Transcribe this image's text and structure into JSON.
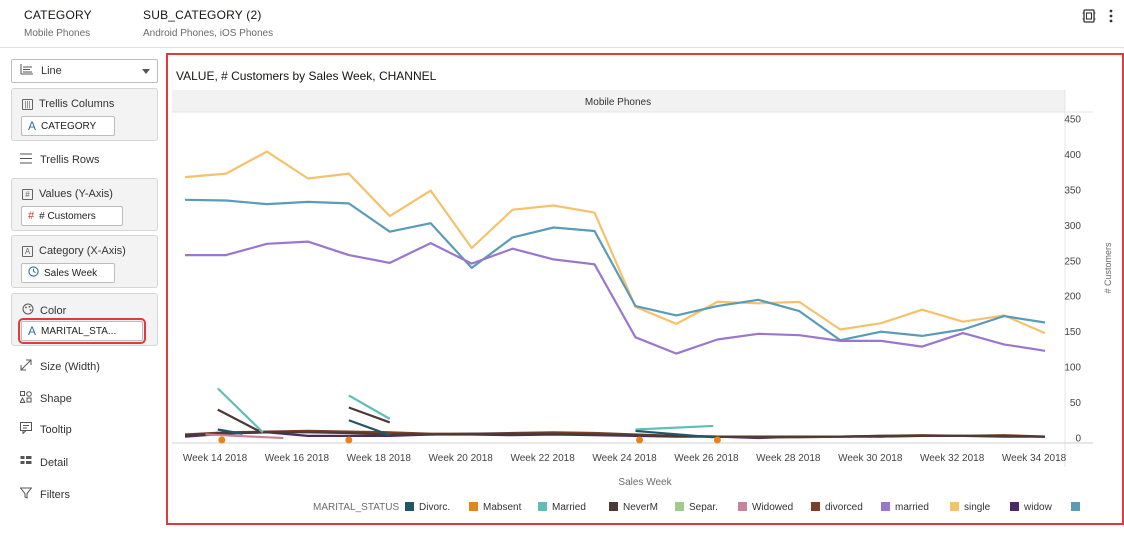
{
  "topbar": {
    "category_label": "CATEGORY",
    "category_value": "Mobile Phones",
    "subcategory_label": "SUB_CATEGORY (2)",
    "subcategory_value": "Android Phones, iOS Phones"
  },
  "panel": {
    "chart_type": "Line",
    "trellis_columns": "Trellis Columns",
    "trellis_columns_value": "CATEGORY",
    "trellis_rows": "Trellis Rows",
    "values_y": "Values (Y-Axis)",
    "values_y_value": "# Customers",
    "category_x": "Category (X-Axis)",
    "category_x_value": "Sales Week",
    "color": "Color",
    "color_value": "MARITAL_STA...",
    "size": "Size (Width)",
    "shape": "Shape",
    "tooltip": "Tooltip",
    "detail": "Detail",
    "filters": "Filters"
  },
  "colors": {
    "highlight": "#e03a3a",
    "single": "#f6c16b",
    "widow": "#5a9cb8",
    "married": "#9a77cc"
  },
  "chart_data": {
    "type": "line",
    "title": "VALUE, # Customers by Sales Week, CHANNEL",
    "panel_header": "Mobile Phones",
    "xlabel": "Sales Week",
    "ylabel": "# Customers",
    "ylim": [
      0,
      450
    ],
    "y_ticks": [
      0,
      50,
      100,
      150,
      200,
      250,
      300,
      350,
      400,
      450
    ],
    "axis_position": "right",
    "x_ticks": [
      "Week 14 2018",
      "Week 16 2018",
      "Week 18 2018",
      "Week 20 2018",
      "Week 22 2018",
      "Week 24 2018",
      "Week 26 2018",
      "Week 28 2018",
      "Week 30 2018",
      "Week 32 2018",
      "Week 34 2018"
    ],
    "x": [
      "Week 14 2018",
      "Week 15 2018",
      "Week 16 2018",
      "Week 17 2018",
      "Week 18 2018",
      "Week 19 2018",
      "Week 20 2018",
      "Week 21 2018",
      "Week 22 2018",
      "Week 23 2018",
      "Week 24 2018",
      "Week 25 2018",
      "Week 26 2018",
      "Week 27 2018",
      "Week 28 2018",
      "Week 29 2018",
      "Week 30 2018",
      "Week 31 2018",
      "Week 32 2018",
      "Week 33 2018",
      "Week 34 2018",
      "Week 35 2018"
    ],
    "legend_title": "MARITAL_STATUS",
    "legend_position": "bottom",
    "legend": [
      {
        "name": "Divorc.",
        "color": "#1f5668"
      },
      {
        "name": "Mabsent",
        "color": "#e2861b"
      },
      {
        "name": "Married",
        "color": "#5fbfb5"
      },
      {
        "name": "NeverM",
        "color": "#4b3a35"
      },
      {
        "name": "Separ.",
        "color": "#9fcb8b"
      },
      {
        "name": "Widowed",
        "color": "#c9849b"
      },
      {
        "name": "divorced",
        "color": "#7a4028"
      },
      {
        "name": "married",
        "color": "#9a77cc"
      },
      {
        "name": "single",
        "color": "#f6c16b"
      },
      {
        "name": "widow",
        "color": "#4b2a6a"
      },
      {
        "name": "",
        "color": "#5a9cb8"
      }
    ],
    "series": [
      {
        "key": "single",
        "color": "#f6c16b",
        "values": [
          368,
          373,
          404,
          366,
          373,
          313,
          349,
          268,
          322,
          328,
          318,
          185,
          161,
          192,
          190,
          192,
          153,
          162,
          181,
          164,
          173,
          148
        ]
      },
      {
        "key": "blue",
        "color": "#5a9cb8",
        "values": [
          336,
          335,
          330,
          333,
          331,
          291,
          303,
          240,
          283,
          297,
          292,
          186,
          173,
          186,
          195,
          179,
          138,
          150,
          144,
          153,
          172,
          163
        ]
      },
      {
        "key": "married",
        "color": "#9a77cc",
        "values": [
          258,
          258,
          274,
          277,
          258,
          247,
          275,
          246,
          267,
          252,
          245,
          142,
          119,
          139,
          147,
          145,
          137,
          137,
          129,
          148,
          132,
          123
        ]
      },
      {
        "key": "widow",
        "color": "#4b2a6a",
        "values": [
          2,
          6,
          8,
          3,
          3,
          3,
          5,
          5,
          4,
          5,
          4,
          3,
          2,
          2,
          0,
          2,
          2,
          2,
          3,
          3,
          2,
          2
        ]
      },
      {
        "key": "divorced",
        "color": "#7a4028",
        "values": [
          5,
          8,
          9,
          10,
          9,
          8,
          6,
          6,
          7,
          8,
          7,
          5,
          3,
          2,
          1,
          1,
          2,
          3,
          4,
          3,
          4,
          2
        ]
      },
      {
        "key": "NeverM",
        "color": "#4b3a35",
        "values": [
          4,
          7,
          8,
          8,
          7,
          5,
          5,
          6,
          6,
          6,
          5,
          4,
          3,
          2,
          2,
          2,
          2,
          3,
          3,
          3,
          3,
          2
        ]
      }
    ],
    "fragments": [
      {
        "key": "Married-a",
        "color": "#5fbfb5",
        "from": 0.8,
        "to": 1.9,
        "values": [
          70,
          8
        ]
      },
      {
        "key": "Married-b",
        "color": "#5fbfb5",
        "from": 4.0,
        "to": 5.0,
        "values": [
          60,
          27
        ]
      },
      {
        "key": "Married-c",
        "color": "#5fbfb5",
        "from": 11.0,
        "to": 12.9,
        "values": [
          12,
          17
        ]
      },
      {
        "key": "NeverM-a",
        "color": "#4b3a35",
        "from": 0.8,
        "to": 1.8,
        "values": [
          40,
          10
        ]
      },
      {
        "key": "NeverM-b",
        "color": "#4b3a35",
        "from": 4.0,
        "to": 5.0,
        "values": [
          43,
          22
        ]
      },
      {
        "key": "Divorc-a",
        "color": "#1f5668",
        "from": 0.8,
        "to": 1.4,
        "values": [
          12,
          6
        ]
      },
      {
        "key": "Divorc-b",
        "color": "#1f5668",
        "from": 4.0,
        "to": 5.0,
        "values": [
          25,
          4
        ]
      },
      {
        "key": "Divorc-c",
        "color": "#1f5668",
        "from": 11.0,
        "to": 12.9,
        "values": [
          10,
          1
        ]
      },
      {
        "key": "Widowed-a",
        "color": "#c9849b",
        "from": 0.5,
        "to": 2.4,
        "values": [
          5,
          0
        ]
      }
    ],
    "markers": [
      {
        "key": "Mabsent",
        "color": "#e2861b",
        "x_index": [
          0.9,
          4.0,
          11.1,
          13.0
        ],
        "value": 0
      }
    ]
  }
}
